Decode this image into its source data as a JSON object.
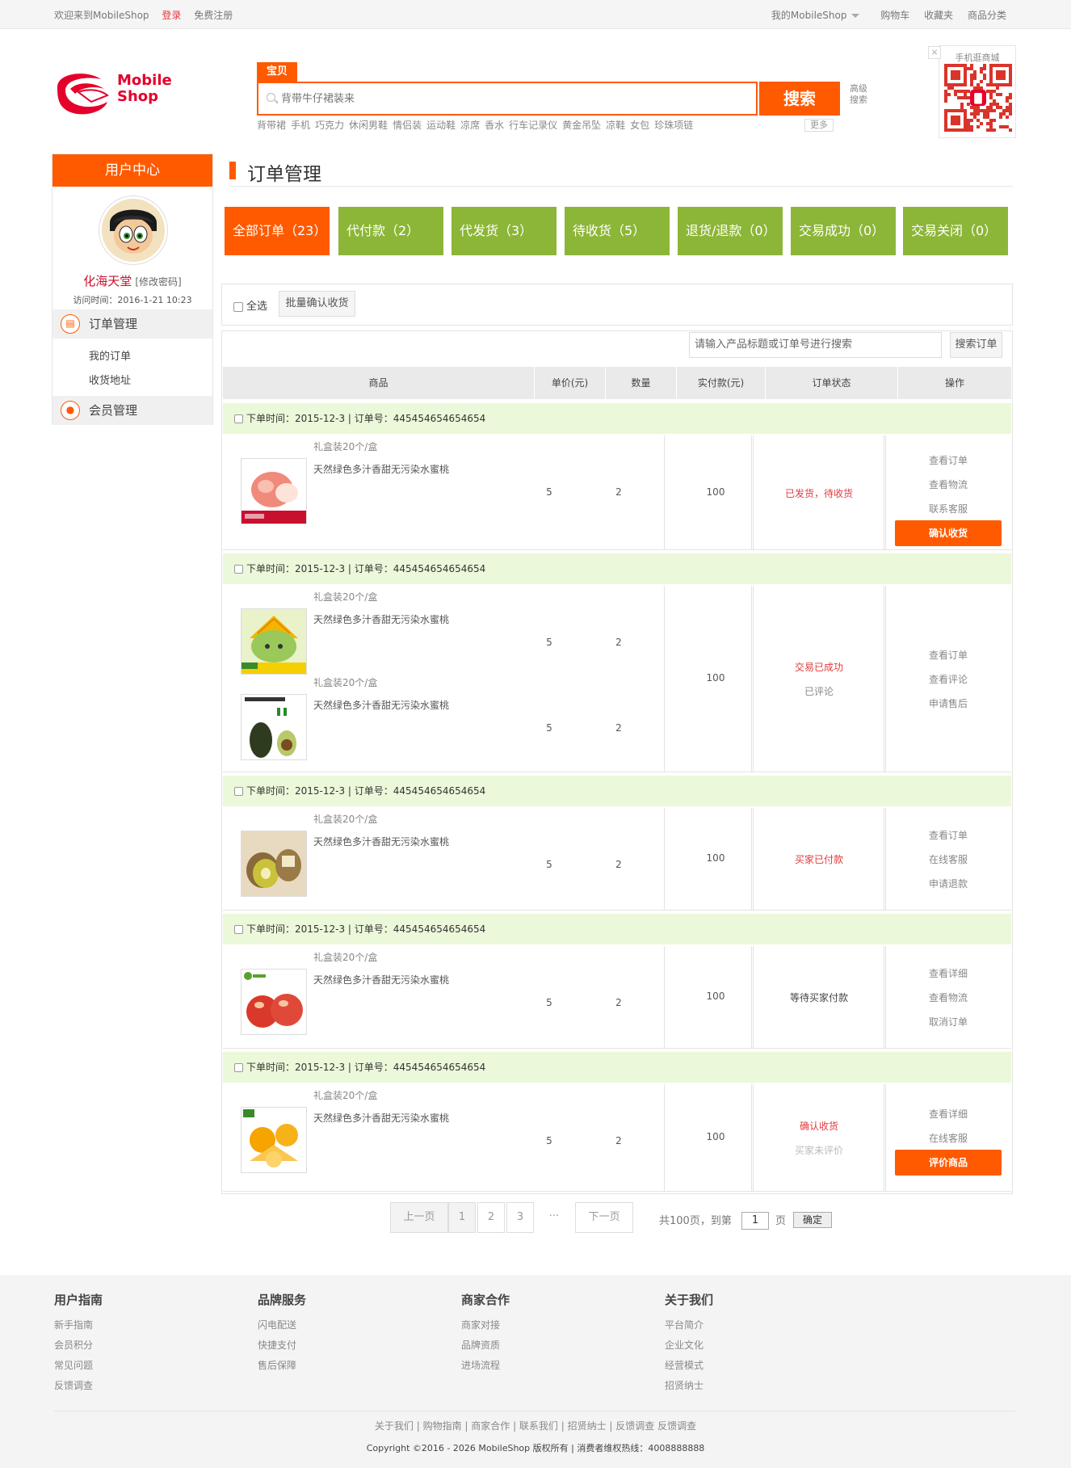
{
  "topbar": {
    "welcome": "欢迎来到MobileShop",
    "login": "登录",
    "register": "免费注册",
    "my_shop": "我的MobileShop",
    "cart": "购物车",
    "favorites": "收藏夹",
    "categories": "商品分类"
  },
  "logo": {
    "line1": "Mobile",
    "line2": "Shop"
  },
  "search": {
    "tab": "宝贝",
    "placeholder": "背带牛仔裙装来",
    "button": "搜索",
    "advanced": "高级搜索",
    "hot_words": [
      "背带裙",
      "手机",
      "巧克力",
      "休闲男鞋",
      "情侣装",
      "运动鞋",
      "凉席",
      "香水",
      "行车记录仪",
      "黄金吊坠",
      "凉鞋",
      "女包",
      "珍珠项链"
    ],
    "more": "更多"
  },
  "qr": {
    "title": "手机逛商城",
    "close": "×"
  },
  "sidebar": {
    "title": "用户中心",
    "username": "化海天堂",
    "change_password": "[修改密码]",
    "visit_time": "访问时间：2016-1-21 10:23",
    "sections": [
      {
        "label": "订单管理",
        "items": [
          "我的订单",
          "收货地址"
        ]
      },
      {
        "label": "会员管理",
        "items": []
      }
    ]
  },
  "main": {
    "title": "订单管理",
    "tabs": [
      "全部订单（23）",
      "代付款（2）",
      "代发货（3）",
      "待收货（5）",
      "退货/退款（0）",
      "交易成功（0）",
      "交易关闭（0）"
    ],
    "select_all": "全选",
    "bulk_confirm": "批量确认收货",
    "order_search_placeholder": "请输入产品标题或订单号进行搜索",
    "order_search_button": "搜索订单",
    "columns": [
      "商品",
      "单价(元)",
      "数量",
      "实付款(元)",
      "订单状态",
      "操作"
    ]
  },
  "orders": [
    {
      "header": "下单时间：2015-12-3 | 订单号：445454654654654",
      "items": [
        {
          "spec": "礼盒装20个/盒",
          "name": "天然绿色多汁香甜无污染水蜜桃",
          "price": "5",
          "qty": "2",
          "img": "peach"
        }
      ],
      "total": "100",
      "status": [
        "已发货，待收货"
      ],
      "status_colors": [
        "#e4393c"
      ],
      "actions": [
        "查看订单",
        "查看物流",
        "联系客服"
      ],
      "button": "确认收货"
    },
    {
      "header": "下单时间：2015-12-3 | 订单号：445454654654654",
      "items": [
        {
          "spec": "礼盒装20个/盒",
          "name": "天然绿色多汁香甜无污染水蜜桃",
          "price": "5",
          "qty": "2",
          "img": "mango"
        },
        {
          "spec": "礼盒装20个/盒",
          "name": "天然绿色多汁香甜无污染水蜜桃",
          "price": "5",
          "qty": "2",
          "img": "avocado"
        }
      ],
      "total": "100",
      "status": [
        "交易已成功",
        "已评论"
      ],
      "status_colors": [
        "#e4393c",
        "#888888"
      ],
      "actions": [
        "查看订单",
        "查看评论",
        "申请售后"
      ],
      "button": ""
    },
    {
      "header": "下单时间：2015-12-3 | 订单号：445454654654654",
      "items": [
        {
          "spec": "礼盒装20个/盒",
          "name": "天然绿色多汁香甜无污染水蜜桃",
          "price": "5",
          "qty": "2",
          "img": "kiwi"
        }
      ],
      "total": "100",
      "status": [
        "买家已付款"
      ],
      "status_colors": [
        "#e4393c"
      ],
      "actions": [
        "查看订单",
        "在线客服",
        "申请退款"
      ],
      "button": ""
    },
    {
      "header": "下单时间：2015-12-3 | 订单号：445454654654654",
      "items": [
        {
          "spec": "礼盒装20个/盒",
          "name": "天然绿色多汁香甜无污染水蜜桃",
          "price": "5",
          "qty": "2",
          "img": "apple"
        }
      ],
      "total": "100",
      "status": [
        "等待买家付款"
      ],
      "status_colors": [
        "#444444"
      ],
      "actions": [
        "查看详细",
        "查看物流",
        "取消订单"
      ],
      "button": ""
    },
    {
      "header": "下单时间：2015-12-3 | 订单号：445454654654654",
      "items": [
        {
          "spec": "礼盒装20个/盒",
          "name": "天然绿色多汁香甜无污染水蜜桃",
          "price": "5",
          "qty": "2",
          "img": "orange"
        }
      ],
      "total": "100",
      "status": [
        "确认收货",
        "买家未评价"
      ],
      "status_colors": [
        "#e4393c",
        "#bbbbbb"
      ],
      "actions": [
        "查看详细",
        "在线客服"
      ],
      "button": "评价商品"
    }
  ],
  "pagination": {
    "prev": "上一页",
    "pages": [
      "1",
      "2",
      "3"
    ],
    "ellipsis": "···",
    "next": "下一页",
    "total_text": "共100页，到第",
    "page_value": "1",
    "page_unit": "页",
    "confirm": "确定"
  },
  "footer": {
    "columns": [
      {
        "title": "用户指南",
        "links": [
          "新手指南",
          "会员积分",
          "常见问题",
          "反馈调查"
        ]
      },
      {
        "title": "品牌服务",
        "links": [
          "闪电配送",
          "快捷支付",
          "售后保障"
        ]
      },
      {
        "title": "商家合作",
        "links": [
          "商家对接",
          "品牌资质",
          "进场流程"
        ]
      },
      {
        "title": "关于我们",
        "links": [
          "平台简介",
          "企业文化",
          "经营模式",
          "招贤纳士"
        ]
      }
    ],
    "bottom_links": "关于我们 | 购物指南 | 商家合作 | 联系我们 | 招贤纳士 | 反馈调查  反馈调查",
    "copyright": "Copyright ©2016 - 2026 MobileShop 版权所有 | 消费者维权热线：4008888888"
  },
  "colors": {
    "accent": "#ff5a00",
    "tab_green": "#8cb637",
    "order_header": "#ebf8d9",
    "status_red": "#e4393c"
  }
}
